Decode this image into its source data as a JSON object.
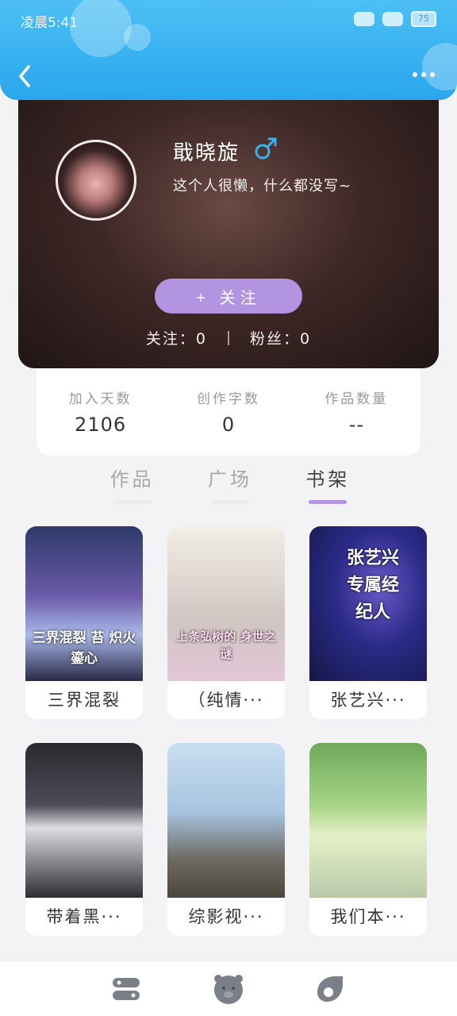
{
  "status_bar": {
    "time": "凌晨5:41",
    "battery": "75"
  },
  "header": {
    "accent": "#2aa6ee"
  },
  "profile": {
    "name": "戢晓旋",
    "gender_symbol": "♂",
    "bio": "这个人很懒，什么都没写~",
    "follow_label": "+ 关注",
    "following_label": "关注：0",
    "fans_label": "粉丝：0"
  },
  "info": [
    {
      "label": "加入天数",
      "value": "2106"
    },
    {
      "label": "创作字数",
      "value": "0"
    },
    {
      "label": "作品数量",
      "value": "--"
    }
  ],
  "tabs": [
    {
      "label": "作品",
      "active": false
    },
    {
      "label": "广场",
      "active": false
    },
    {
      "label": "书架",
      "active": true
    }
  ],
  "books": [
    {
      "title": "三界混裂",
      "cover_text": "三界混裂 苔 炽火鎏心"
    },
    {
      "title": "（纯情···",
      "cover_text": "上条弘树的 身世之谜"
    },
    {
      "title": "张艺兴···",
      "cover_text": "张艺兴 专属经纪人"
    },
    {
      "title": "带着黑···",
      "cover_text": ""
    },
    {
      "title": "综影视···",
      "cover_text": ""
    },
    {
      "title": "我们本···",
      "cover_text": ""
    }
  ],
  "bottom_nav": [
    {
      "icon": "home-icon"
    },
    {
      "icon": "bear-face-icon"
    },
    {
      "icon": "discover-icon"
    }
  ]
}
